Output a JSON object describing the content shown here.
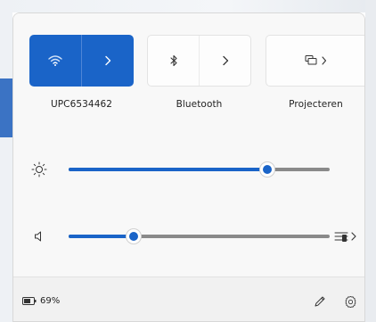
{
  "quick_settings": {
    "tiles": [
      {
        "label": "UPC6534462",
        "icon": "wifi-icon",
        "active": true
      },
      {
        "label": "Bluetooth",
        "icon": "bluetooth-icon",
        "active": false
      },
      {
        "label": "Projecteren",
        "icon": "project-icon",
        "active": false
      }
    ],
    "brightness": {
      "icon": "brightness-icon",
      "level_percent": 76
    },
    "volume": {
      "icon": "speaker-icon",
      "level_percent": 25
    }
  },
  "footer": {
    "battery_text": "69%",
    "battery_icon": "battery-icon",
    "edit_icon": "pencil-icon",
    "settings_icon": "gear-icon"
  },
  "colors": {
    "accent": "#1a64c8",
    "panel_bg": "#f8f8f8",
    "track": "#8a8a8a"
  }
}
